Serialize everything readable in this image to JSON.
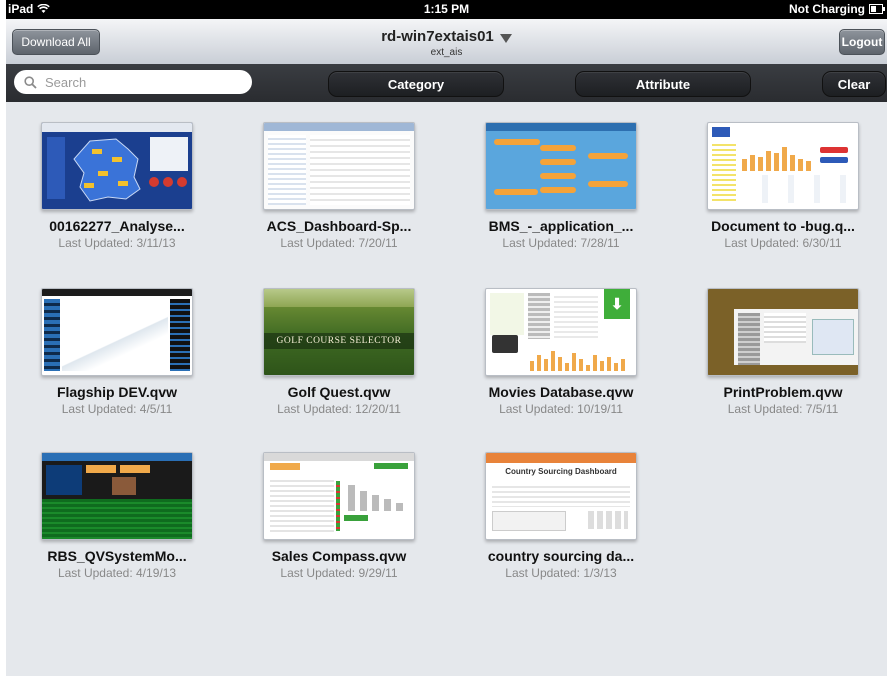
{
  "status": {
    "device": "iPad",
    "time": "1:15 PM",
    "battery": "Not Charging"
  },
  "nav": {
    "download_all": "Download All",
    "title": "rd-win7extais01",
    "subtitle": "ext_ais",
    "logout": "Logout"
  },
  "filters": {
    "search_placeholder": "Search",
    "category": "Category",
    "attribute": "Attribute",
    "clear": "Clear"
  },
  "documents": [
    {
      "name": "00162277_Analyse...",
      "updated": "Last Updated: 3/11/13"
    },
    {
      "name": "ACS_Dashboard-Sp...",
      "updated": "Last Updated: 7/20/11"
    },
    {
      "name": "BMS_-_application_...",
      "updated": "Last Updated: 7/28/11"
    },
    {
      "name": "Document to -bug.q...",
      "updated": "Last Updated: 6/30/11"
    },
    {
      "name": "Flagship DEV.qvw",
      "updated": "Last Updated: 4/5/11"
    },
    {
      "name": "Golf Quest.qvw",
      "updated": "Last Updated: 12/20/11",
      "thumb_text": "GOLF COURSE SELECTOR"
    },
    {
      "name": "Movies Database.qvw",
      "updated": "Last Updated: 10/19/11"
    },
    {
      "name": "PrintProblem.qvw",
      "updated": "Last Updated: 7/5/11"
    },
    {
      "name": "RBS_QVSystemMo...",
      "updated": "Last Updated: 4/19/13"
    },
    {
      "name": "Sales Compass.qvw",
      "updated": "Last Updated: 9/29/11"
    },
    {
      "name": "country sourcing da...",
      "updated": "Last Updated: 1/3/13",
      "thumb_text": "Country Sourcing Dashboard"
    }
  ]
}
